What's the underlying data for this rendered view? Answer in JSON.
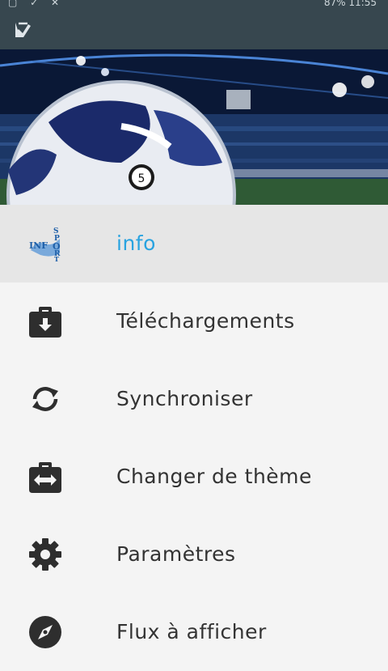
{
  "status_bar": {
    "left_icons": [
      "notification-icon",
      "check-icon",
      "mute-icon"
    ],
    "battery": "87%",
    "time": "11:55"
  },
  "app_bar": {
    "icon": "app-logo-icon"
  },
  "header": {
    "image": "football-stadium-image"
  },
  "drawer": {
    "accent_color": "#29a3e0",
    "items": [
      {
        "label": "info",
        "icon": "info-sport-logo",
        "selected": true
      },
      {
        "label": "Téléchargements",
        "icon": "download-briefcase-icon"
      },
      {
        "label": "Synchroniser",
        "icon": "sync-icon"
      },
      {
        "label": "Changer de thème",
        "icon": "swap-theme-icon"
      },
      {
        "label": "Paramètres",
        "icon": "settings-gear-icon"
      },
      {
        "label": "Flux à afficher",
        "icon": "compass-icon"
      }
    ]
  }
}
